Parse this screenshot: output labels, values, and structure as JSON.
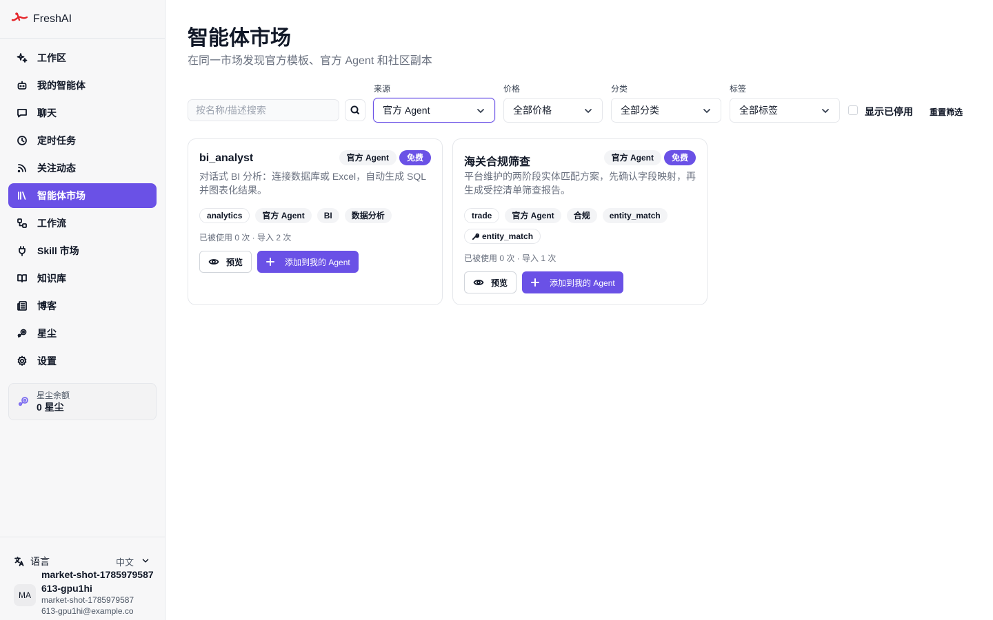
{
  "app": {
    "name": "FreshAI",
    "brand_color": "#e5252a"
  },
  "sidebar": {
    "items": [
      {
        "label": "工作区",
        "icon": "sparkles-icon"
      },
      {
        "label": "我的智能体",
        "icon": "bot-icon"
      },
      {
        "label": "聊天",
        "icon": "chat-icon"
      },
      {
        "label": "定时任务",
        "icon": "clock-icon"
      },
      {
        "label": "关注动态",
        "icon": "rss-icon"
      },
      {
        "label": "智能体市场",
        "icon": "library-icon",
        "active": true
      },
      {
        "label": "工作流",
        "icon": "workflow-icon"
      },
      {
        "label": "Skill 市场",
        "icon": "plug-icon"
      },
      {
        "label": "知识库",
        "icon": "book-icon"
      },
      {
        "label": "博客",
        "icon": "newspaper-icon"
      },
      {
        "label": "星尘",
        "icon": "stardust-icon"
      },
      {
        "label": "设置",
        "icon": "gear-icon"
      }
    ],
    "balance": {
      "label": "星尘余额",
      "value": "0 星尘"
    },
    "language": {
      "label": "语言",
      "value": "中文"
    },
    "user": {
      "initials": "MA",
      "name": "market-shot-1785979587613-gpu1hi",
      "email": "market-shot-1785979587613-gpu1hi@example.com"
    }
  },
  "page": {
    "title": "智能体市场",
    "subtitle": "在同一市场发现官方模板、官方 Agent 和社区副本"
  },
  "filters": {
    "search_placeholder": "按名称/描述搜索",
    "source": {
      "label": "来源",
      "value": "官方 Agent"
    },
    "price": {
      "label": "价格",
      "value": "全部价格"
    },
    "category": {
      "label": "分类",
      "value": "全部分类"
    },
    "tag": {
      "label": "标签",
      "value": "全部标签"
    },
    "show_disabled": "显示已停用",
    "reset": "重置筛选"
  },
  "cards": [
    {
      "title": "bi_analyst",
      "badge_source": "官方 Agent",
      "badge_price": "免费",
      "desc": "对话式 BI 分析：连接数据库或 Excel，自动生成 SQL 并图表化结果。",
      "tags": [
        "analytics",
        "官方 Agent",
        "BI",
        "数据分析"
      ],
      "stats": "已被使用 0 次 · 导入 2 次",
      "preview": "预览",
      "add": "添加到我的 Agent"
    },
    {
      "title": "海关合规筛查",
      "badge_source": "官方 Agent",
      "badge_price": "免费",
      "desc": "平台维护的两阶段实体匹配方案，先确认字段映射，再生成受控清单筛查报告。",
      "tags": [
        "trade",
        "官方 Agent",
        "合规",
        "entity_match"
      ],
      "skill_tag": "entity_match",
      "stats": "已被使用 0 次 · 导入 1 次",
      "preview": "预览",
      "add": "添加到我的 Agent"
    }
  ]
}
